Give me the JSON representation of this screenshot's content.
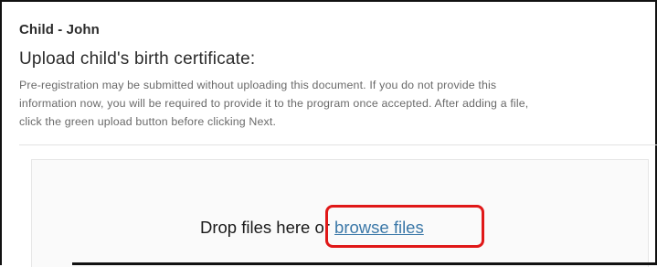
{
  "section": {
    "child_title": "Child - John"
  },
  "upload": {
    "heading": "Upload child's birth certificate:",
    "help_lines": [
      "Pre-registration may be submitted without uploading this document. If you do not provide this",
      "information now, you will be required to provide it to the program once accepted. After adding a file,",
      "click the green upload button before clicking Next."
    ]
  },
  "dropzone": {
    "prompt": "Drop files here or ",
    "browse_label": "browse files"
  },
  "colors": {
    "link": "#3b78a8",
    "highlight": "#e01818"
  }
}
